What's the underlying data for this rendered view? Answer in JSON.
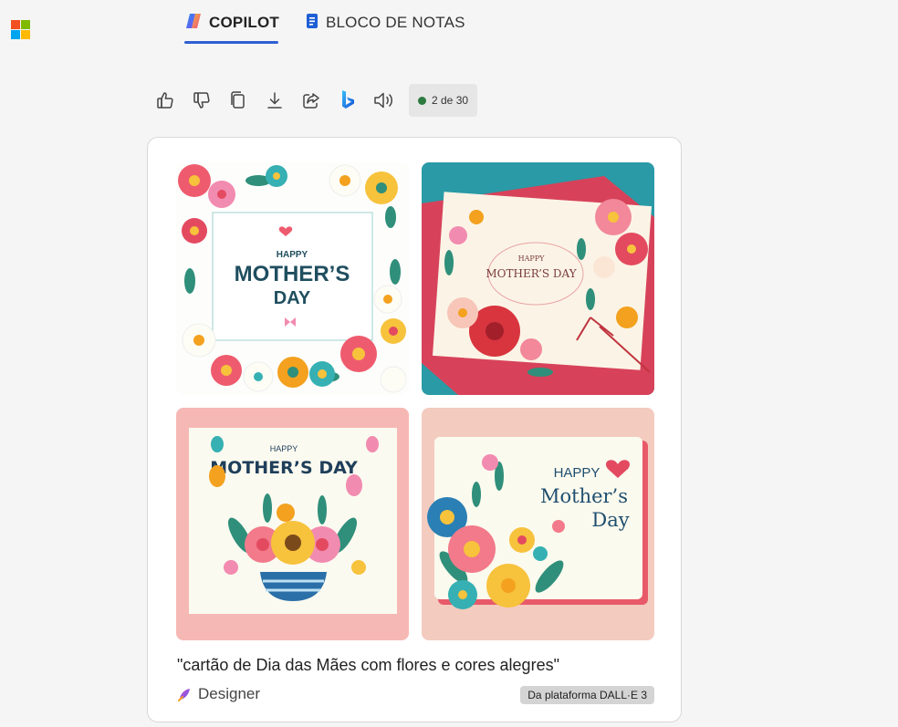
{
  "header": {
    "tabs": [
      {
        "label": "COPILOT",
        "icon": "copilot-icon",
        "active": true
      },
      {
        "label": "BLOCO DE NOTAS",
        "icon": "notebook-icon",
        "active": false
      }
    ],
    "logo": "microsoft-logo",
    "colors": {
      "accent": "#2f5fd4"
    }
  },
  "toolbar": {
    "actions": [
      "thumbs-up-icon",
      "thumbs-down-icon",
      "copy-icon",
      "download-icon",
      "share-icon",
      "bing-icon",
      "speaker-icon"
    ],
    "counter": "2 de 30",
    "counter_status_color": "#2c7a3f"
  },
  "result": {
    "images": [
      {
        "lines": [
          "HAPPY",
          "MOTHER’S",
          "DAY"
        ]
      },
      {
        "lines": [
          "HAPPY",
          "MOTHER’S DAY"
        ]
      },
      {
        "lines": [
          "HAPPY",
          "MOTHER’S DAY"
        ]
      },
      {
        "lines": [
          "HAPPY",
          "Mother’s",
          "Day"
        ]
      }
    ],
    "prompt": "\"cartão de Dia das Mães com flores e cores alegres\"",
    "source_label": "Designer",
    "platform_badge": "Da plataforma DALL·E 3"
  }
}
